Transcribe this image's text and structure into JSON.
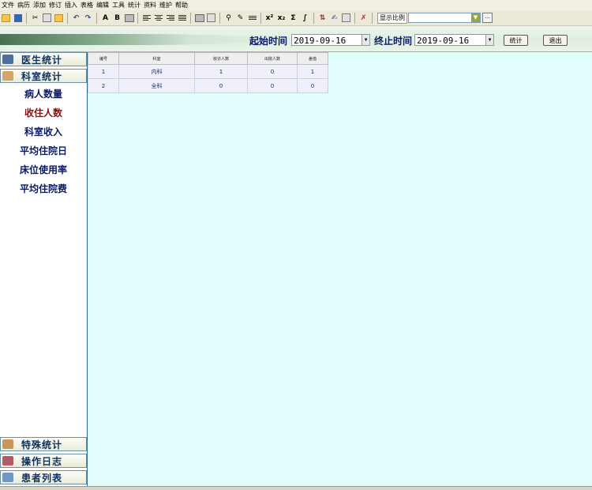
{
  "menu": [
    "文件",
    "病历",
    "添加",
    "修订",
    "插入",
    "表格",
    "编辑",
    "工具",
    "统计",
    "资料",
    "维护",
    "帮助"
  ],
  "toolbar": {
    "bold": "B",
    "italic_a": "A",
    "superscript": "x²",
    "subscript": "x₂",
    "sigma": "Σ",
    "integral": "∫",
    "zoom_label": "显示比例",
    "zoom_more": "..."
  },
  "filter": {
    "start_label": "起始时间",
    "start_value": "2019-09-16",
    "end_label": "终止时间",
    "end_value": "2019-09-16",
    "stat_button": "统计",
    "exit_button": "退出"
  },
  "sidebar": {
    "top_categories": [
      "医生统计",
      "科室统计"
    ],
    "items": [
      "病人数量",
      "收住人数",
      "科室收入",
      "平均住院日",
      "床位使用率",
      "平均住院费"
    ],
    "bottom_categories": [
      "特殊统计",
      "操作日志",
      "患者列表"
    ]
  },
  "table": {
    "headers": [
      "编号",
      "科室",
      "收诊人数",
      "出院人数",
      "差值"
    ],
    "rows": [
      [
        "1",
        "内科",
        "1",
        "0",
        "1"
      ],
      [
        "2",
        "全科",
        "0",
        "0",
        "0"
      ]
    ]
  },
  "colors": {
    "main_bg": "#e0fdfc",
    "sidebar_text": "#0a1a66",
    "active_item": "#8b1010"
  }
}
